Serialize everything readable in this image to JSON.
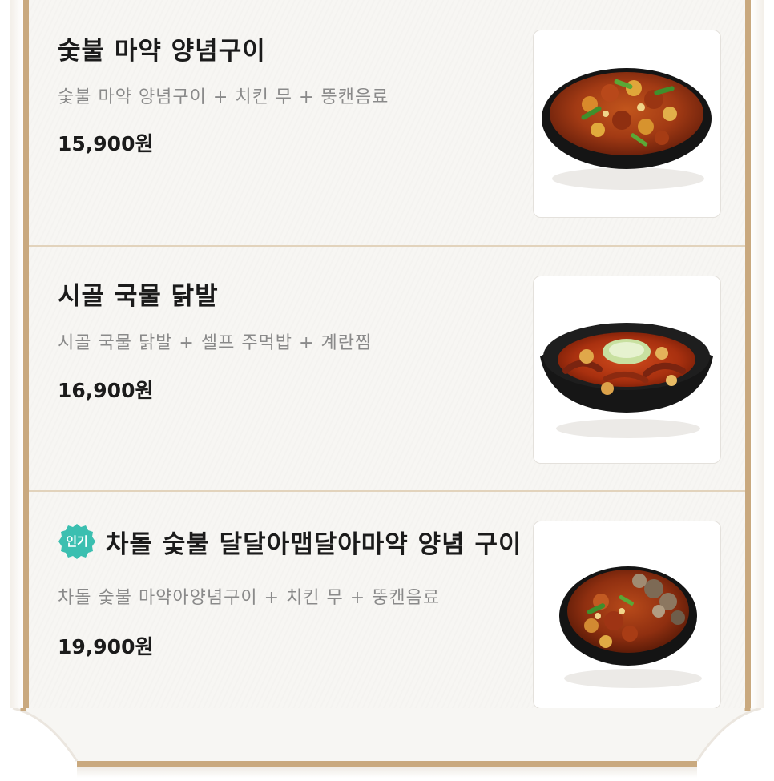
{
  "menu": {
    "items": [
      {
        "title": "숯불 마약 양념구이",
        "description": "숯불 마약 양념구이 + 치킨 무 + 뚱캔음료",
        "price": "15,900원",
        "badge": null
      },
      {
        "title": "시골 국물 닭발",
        "description": "시골 국물 닭발 + 셀프 주먹밥 + 계란찜",
        "price": "16,900원",
        "badge": null
      },
      {
        "title": "차돌 숯불 달달아맵달아마약 양념 구이",
        "description": "차돌 숯불 마약아양념구이 + 치킨 무 + 뚱캔음료",
        "price": "19,900원",
        "badge": "인기"
      }
    ]
  },
  "colors": {
    "border": "#c9a97f",
    "paper": "#f7f6f3",
    "divider": "#e2d3bc",
    "badge": "#3bbfb0",
    "title": "#1b1b1b",
    "description": "#8a8a8a"
  },
  "icons": {
    "badge_shape": "scalloped-badge"
  }
}
